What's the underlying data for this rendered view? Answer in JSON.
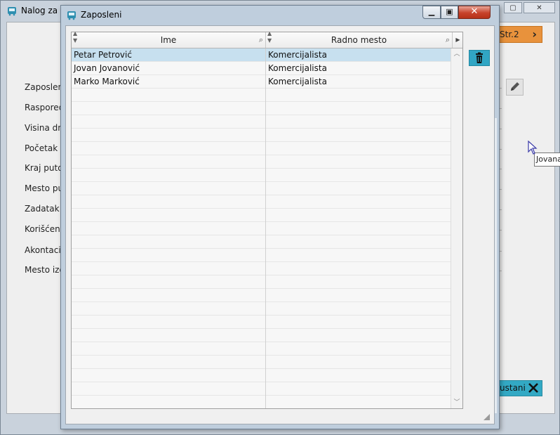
{
  "background_window": {
    "title": "Nalog za s",
    "form_labels": [
      "Zaposlen",
      "Raspoređ",
      "Visina dn",
      "Početak p",
      "Kraj puto",
      "Mesto put",
      "Zadatak",
      "Korišćen",
      "Akontacij",
      "Mesto izd"
    ],
    "next_page_label": "Str.2",
    "cancel_label": "ustani",
    "tooltip_text": "Jovana",
    "accent_orange": "#e8923c",
    "accent_teal": "#33a9c4"
  },
  "dialog": {
    "title": "Zaposleni",
    "grid": {
      "columns": [
        {
          "label": "Ime"
        },
        {
          "label": "Radno mesto"
        }
      ],
      "rows": [
        {
          "ime": "Petar Petrović",
          "radno_mesto": "Komercijalista",
          "selected": true
        },
        {
          "ime": "Jovan Jovanović",
          "radno_mesto": "Komercijalista",
          "selected": false
        },
        {
          "ime": "Marko Marković",
          "radno_mesto": "Komercijalista",
          "selected": false
        }
      ],
      "selection_color": "#c7e0ef"
    },
    "icons": {
      "delete": "trash-icon",
      "search": "magnifier-icon",
      "close": "close-icon"
    }
  }
}
